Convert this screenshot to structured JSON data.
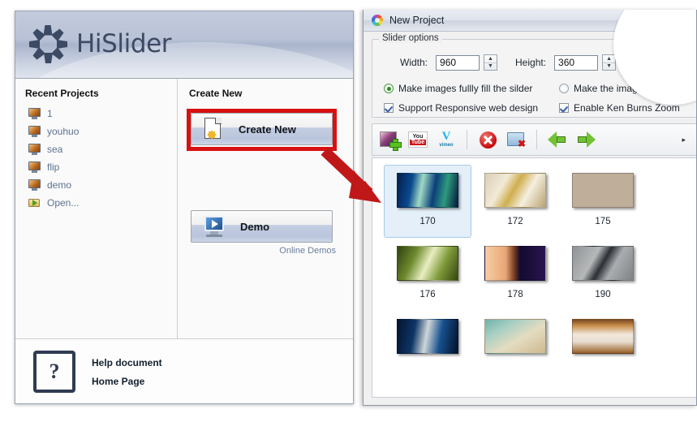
{
  "app": {
    "logo_text_1": "Hi",
    "logo_text_2": "Slider",
    "recent_title": "Recent Projects",
    "recent_items": [
      {
        "label": "1",
        "icon": "monitor-icon"
      },
      {
        "label": "youhuo",
        "icon": "monitor-icon"
      },
      {
        "label": "sea",
        "icon": "monitor-icon"
      },
      {
        "label": "flip",
        "icon": "monitor-icon"
      },
      {
        "label": "demo",
        "icon": "monitor-icon"
      },
      {
        "label": "Open...",
        "icon": "folder-open-icon"
      }
    ],
    "create_title": "Create New",
    "create_button": "Create New",
    "demo_button": "Demo",
    "online_demos": "Online Demos",
    "help_icon_glyph": "?",
    "help_document": "Help document",
    "home_page": "Home Page"
  },
  "dialog": {
    "title": "New Project",
    "title_icon": "color-ring-icon",
    "group_legend": "Slider options",
    "width_label": "Width:",
    "width_value": "960",
    "height_label": "Height:",
    "height_value": "360",
    "radio_fill": "Make images fullly fill the silder",
    "radio_auto": "Make the images autom",
    "check_responsive": "Support Responsive web design",
    "check_kenburns": "Enable Ken Burns Zoom",
    "spinner_up": "▲",
    "spinner_down": "▼",
    "toolbar": [
      {
        "name": "add-image-icon",
        "title": "Add images"
      },
      {
        "name": "youtube-icon",
        "title": "YouTube",
        "text_top": "You",
        "text_bottom": "Tube"
      },
      {
        "name": "vimeo-icon",
        "title": "Vimeo",
        "text_top": "V",
        "text_bottom": "vimeo"
      },
      {
        "name": "delete-icon",
        "title": "Remove"
      },
      {
        "name": "clear-folder-icon",
        "title": "Clear all"
      },
      {
        "name": "arrow-left-icon",
        "title": "Move left"
      },
      {
        "name": "arrow-right-icon",
        "title": "Move right"
      }
    ],
    "toolbar_overflow": "▸",
    "gallery": [
      {
        "label": "170",
        "cls": "t170",
        "selected": true
      },
      {
        "label": "172",
        "cls": "t172",
        "selected": false
      },
      {
        "label": "175",
        "cls": "t175",
        "selected": false
      },
      {
        "label": "176",
        "cls": "t176",
        "selected": false
      },
      {
        "label": "178",
        "cls": "t178",
        "selected": false
      },
      {
        "label": "190",
        "cls": "t190",
        "selected": false
      },
      {
        "label": "",
        "cls": "t191",
        "selected": false
      },
      {
        "label": "",
        "cls": "t192",
        "selected": false
      },
      {
        "label": "",
        "cls": "t193",
        "selected": false
      }
    ]
  },
  "annotation": {
    "highlight_color": "#d81111",
    "arrow_color": "#c01818"
  }
}
